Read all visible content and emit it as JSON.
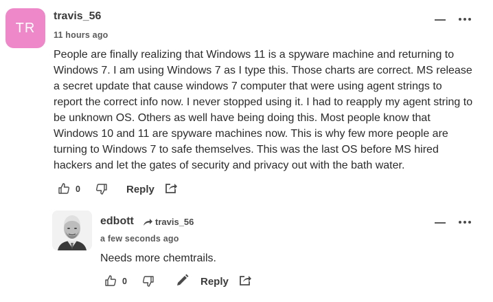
{
  "comment": {
    "avatar_initials": "TR",
    "avatar_color": "#ee88c8",
    "username": "travis_56",
    "timestamp": "11 hours ago",
    "body_lines": [
      "People are finally realizing that Windows 11 is a spyware machine and returning to",
      "Windows 7. I am using Windows 7 as I type this. Those charts are correct. MS release",
      "a secret update that cause windows 7 computer that were using agent strings to",
      "report the correct info now. I never stopped using it. I had to reapply my agent string to",
      "be unknown OS. Others as well have being doing this. Most people know that",
      "Windows 10 and 11 are spyware machines now. This is why few more people are",
      "turning to Windows 7 to safe themselves. This was the last OS before MS hired",
      "hackers and let the gates of security and privacy out with the bath water."
    ],
    "likes": "0",
    "reply_label": "Reply"
  },
  "reply": {
    "username": "edbott",
    "reply_to": "travis_56",
    "timestamp": "a few seconds ago",
    "body": "Needs more chemtrails.",
    "likes": "0",
    "reply_label": "Reply"
  },
  "icons": {
    "upvote": "thumbs-up-icon",
    "downvote": "thumbs-down-icon",
    "share": "share-icon",
    "edit": "pencil-icon",
    "more": "more-dots-icon",
    "collapse": "minus-icon",
    "reply_arrow": "reply-arrow-icon"
  }
}
